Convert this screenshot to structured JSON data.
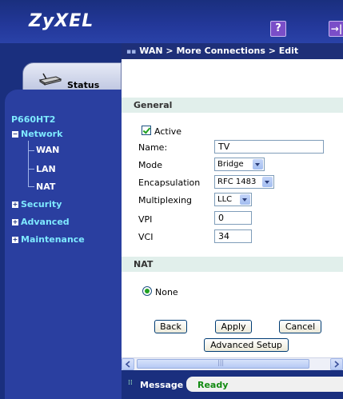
{
  "header": {
    "logo": "ZyXEL",
    "help_icon": "?",
    "logout_icon": "→|"
  },
  "breadcrumb": "WAN > More Connections > Edit",
  "nav": {
    "status_tab": "Status",
    "device": "P660HT2",
    "items": [
      {
        "label": "Network",
        "expanded": true,
        "children": [
          "WAN",
          "LAN",
          "NAT"
        ]
      },
      {
        "label": "Security",
        "expanded": false
      },
      {
        "label": "Advanced",
        "expanded": false
      },
      {
        "label": "Maintenance",
        "expanded": false
      }
    ]
  },
  "general": {
    "title": "General",
    "active_label": "Active",
    "active_checked": true,
    "name_label": "Name:",
    "name_value": "TV",
    "mode_label": "Mode",
    "mode_value": "Bridge",
    "encap_label": "Encapsulation",
    "encap_value": "RFC 1483",
    "mux_label": "Multiplexing",
    "mux_value": "LLC",
    "vpi_label": "VPI",
    "vpi_value": "0",
    "vci_label": "VCI",
    "vci_value": "34"
  },
  "nat": {
    "title": "NAT",
    "option_none": "None",
    "selected": "None"
  },
  "buttons": {
    "back": "Back",
    "apply": "Apply",
    "cancel": "Cancel",
    "advanced_setup": "Advanced Setup"
  },
  "scrollbar": {
    "grip": "|||"
  },
  "message": {
    "label": "Message",
    "text": "Ready"
  },
  "colors": {
    "nav_bg": "#1a2f7e",
    "nav_link": "#7ee9ff",
    "section_bg": "#e1efeb",
    "status_green": "#128a12"
  }
}
